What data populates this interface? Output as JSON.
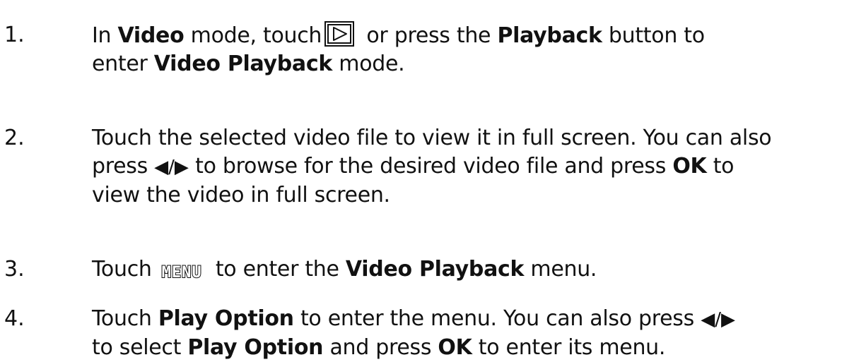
{
  "steps": [
    {
      "number": "1.",
      "parts": {
        "a": "In ",
        "b_video": "Video",
        "c": " mode, touch",
        "d": " or press the ",
        "e_playback": "Playback",
        "f": " button to",
        "g": "enter ",
        "h_vpm": "Video Playback",
        "i": " mode."
      },
      "icon": "playback-icon"
    },
    {
      "number": "2.",
      "parts": {
        "a": "Touch the selected video file to view it in full screen. You can also",
        "b": "press ",
        "arrows": "◀/▶",
        "c": " to browse for the desired video file and press ",
        "d_ok": "OK",
        "e": " to",
        "f": "view the video in full screen."
      }
    },
    {
      "number": "3.",
      "parts": {
        "a": "Touch",
        "menu_icon": "MENU",
        "b": " to enter the ",
        "c_vp": "Video Playback",
        "d": " menu."
      },
      "icon": "menu-icon"
    },
    {
      "number": "4.",
      "parts": {
        "a": "Touch ",
        "b_po": "Play Option",
        "c": " to enter the menu. You can also press ",
        "arrows": "◀/▶",
        "d": "to select ",
        "e_po": "Play Option",
        "f": " and press ",
        "g_ok": "OK",
        "h": " to enter its menu."
      }
    }
  ]
}
